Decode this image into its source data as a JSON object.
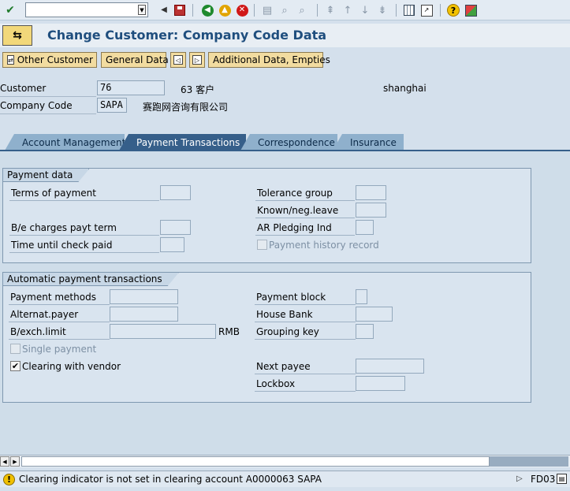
{
  "command_field": {
    "value": ""
  },
  "title": "Change Customer: Company Code Data",
  "app_toolbar": {
    "other_customer": "Other Customer",
    "general_data": "General Data",
    "additional_data": "Additional Data, Empties"
  },
  "header": {
    "customer_label": "Customer",
    "customer_value": "76",
    "customer_name": "63 客户",
    "customer_city": "shanghai",
    "company_code_label": "Company Code",
    "company_code_value": "SAPA",
    "company_name": "赛跑网咨询有限公司"
  },
  "tabs": [
    {
      "label": "Account Management",
      "active": false
    },
    {
      "label": "Payment Transactions",
      "active": true
    },
    {
      "label": "Correspondence",
      "active": false
    },
    {
      "label": "Insurance",
      "active": false
    }
  ],
  "payment_data": {
    "title": "Payment data",
    "terms_of_payment": "Terms of payment",
    "be_charges": "B/e charges payt term",
    "time_until_check": "Time until check paid",
    "tolerance_group": "Tolerance group",
    "known_neg_leave": "Known/neg.leave",
    "ar_pledging": "AR Pledging Ind",
    "payment_history": "Payment history record"
  },
  "auto_payment": {
    "title": "Automatic payment transactions",
    "payment_methods": "Payment methods",
    "alternat_payer": "Alternat.payer",
    "bexch_limit": "B/exch.limit",
    "currency": "RMB",
    "single_payment": "Single payment",
    "clearing_with_vendor": "Clearing with vendor",
    "clearing_checked": true,
    "payment_block": "Payment block",
    "house_bank": "House Bank",
    "grouping_key": "Grouping key",
    "next_payee": "Next payee",
    "lockbox": "Lockbox"
  },
  "status": {
    "message": "Clearing indicator is not set in clearing account A0000063 SAPA",
    "system": "FD03"
  },
  "colors": {
    "title": "#1f4e7e",
    "active_tab": "#365f8a",
    "button": "#f2dca0"
  }
}
